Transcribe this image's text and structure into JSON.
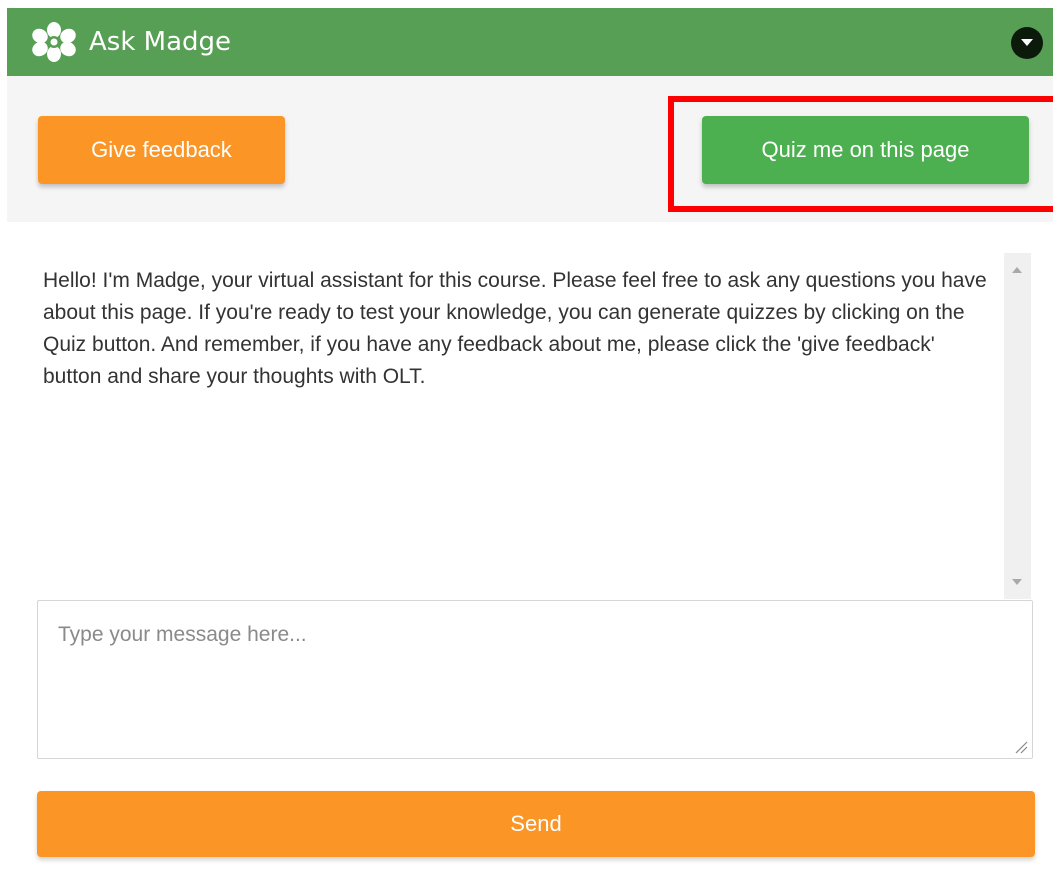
{
  "header": {
    "title": "Ask Madge",
    "logo_icon": "flower-icon",
    "collapse_icon": "chevron-down-circle-icon",
    "color": "#569f54"
  },
  "toolbar": {
    "feedback_label": "Give feedback",
    "quiz_label": "Quiz me on this page"
  },
  "chat": {
    "messages": [
      {
        "text": "Hello! I'm Madge, your virtual assistant for this course. Please feel free to ask any questions you have about this page. If you're ready to test your knowledge, you can generate quizzes by clicking on the Quiz button. And remember, if you have any feedback about me, please click the 'give feedback' button and share your thoughts with OLT."
      }
    ]
  },
  "input": {
    "placeholder": "Type your message here...",
    "value": ""
  },
  "send_label": "Send",
  "colors": {
    "orange": "#fa9526",
    "green_button": "#4caf50",
    "highlight": "#ff0000"
  }
}
